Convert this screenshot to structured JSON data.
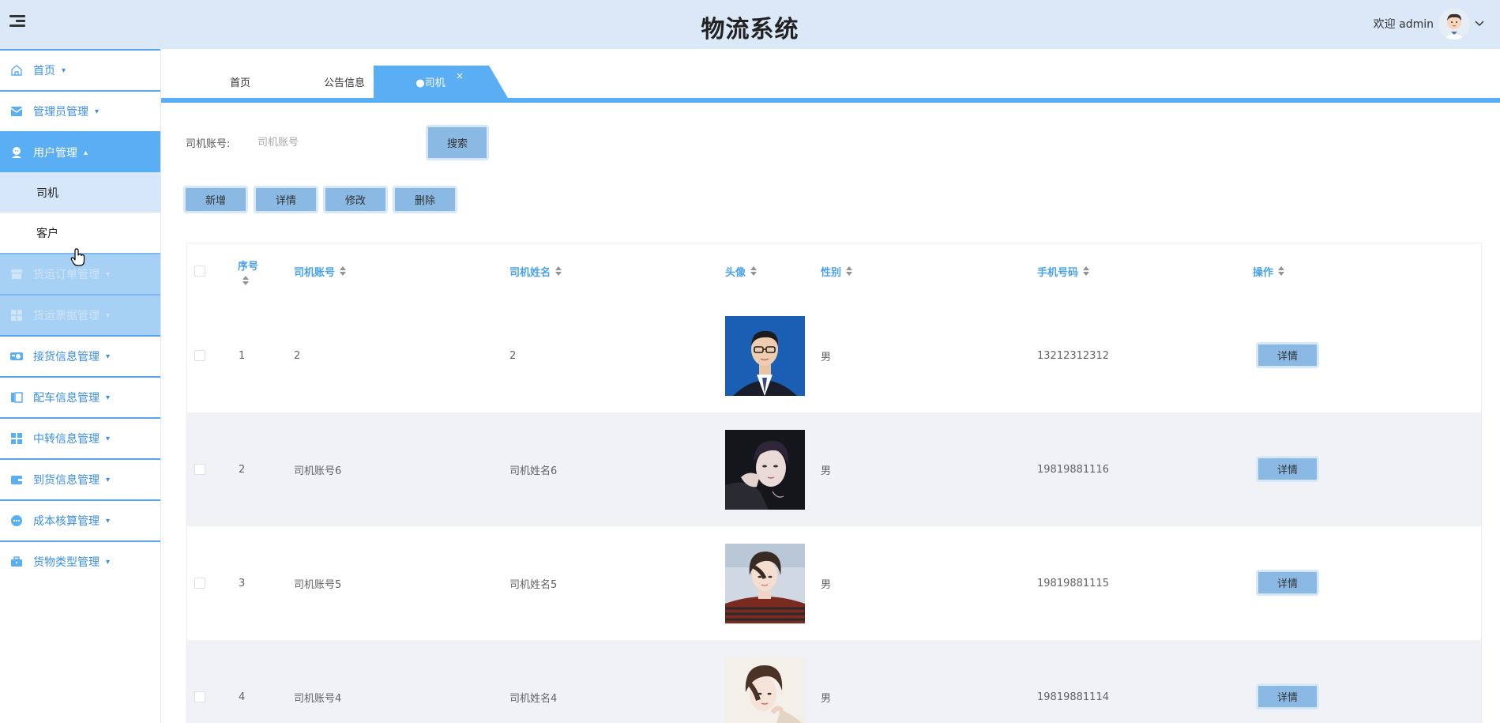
{
  "header": {
    "title": "物流系统",
    "welcome": "欢迎 admin",
    "menu_icon": "hamburger-menu-icon",
    "avatar_icon": "user-avatar"
  },
  "sidebar": {
    "items": [
      {
        "label": "首页",
        "icon": "home-icon",
        "state": "normal"
      },
      {
        "label": "管理员管理",
        "icon": "envelope-icon",
        "state": "normal"
      },
      {
        "label": "用户管理",
        "icon": "user-icon",
        "state": "active"
      },
      {
        "label": "货运订单管理",
        "icon": "box-icon",
        "state": "faded"
      },
      {
        "label": "货运票据管理",
        "icon": "grid-icon",
        "state": "faded"
      },
      {
        "label": "接货信息管理",
        "icon": "camera-icon",
        "state": "normal"
      },
      {
        "label": "配车信息管理",
        "icon": "columns-icon",
        "state": "normal"
      },
      {
        "label": "中转信息管理",
        "icon": "windows-icon",
        "state": "normal"
      },
      {
        "label": "到货信息管理",
        "icon": "wallet-icon",
        "state": "normal"
      },
      {
        "label": "成本核算管理",
        "icon": "dots-icon",
        "state": "normal"
      },
      {
        "label": "货物类型管理",
        "icon": "briefcase-icon",
        "state": "normal"
      }
    ],
    "sub_items": [
      {
        "label": "司机",
        "selected": true
      },
      {
        "label": "客户",
        "selected": false
      }
    ]
  },
  "tabs": [
    {
      "label": "首页",
      "closable": false
    },
    {
      "label": "公告信息",
      "closable": true
    },
    {
      "label": "●司机",
      "closable": true,
      "active": true
    }
  ],
  "tab_close": "×",
  "search": {
    "label": "司机账号:",
    "placeholder": "司机账号",
    "button": "搜索"
  },
  "actions": {
    "add": "新增",
    "detail": "详情",
    "edit": "修改",
    "delete": "删除"
  },
  "table": {
    "columns": [
      "序号",
      "司机账号",
      "司机姓名",
      "头像",
      "性别",
      "手机号码",
      "操作"
    ],
    "detail_label": "详情",
    "rows": [
      {
        "seq": "1",
        "account": "2",
        "name": "2",
        "gender": "男",
        "phone": "13212312312",
        "photo": "photo-suit"
      },
      {
        "seq": "2",
        "account": "司机账号6",
        "name": "司机姓名6",
        "gender": "男",
        "phone": "19819881116",
        "photo": "photo-dark"
      },
      {
        "seq": "3",
        "account": "司机账号5",
        "name": "司机姓名5",
        "gender": "男",
        "phone": "19819881115",
        "photo": "photo-striped"
      },
      {
        "seq": "4",
        "account": "司机账号4",
        "name": "司机姓名4",
        "gender": "男",
        "phone": "19819881114",
        "photo": "photo-light"
      }
    ]
  },
  "colors": {
    "header_bg": "#dbe8f7",
    "accent": "#5aaef3",
    "button_bg": "#8ab9e4",
    "column_header": "#4aa3ea"
  }
}
